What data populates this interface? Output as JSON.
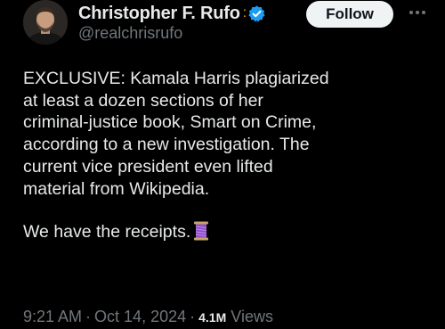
{
  "author": {
    "display_name": "Christopher F. Rufo",
    "name_separator": ":",
    "handle": "@realchrisrufo",
    "verified": true,
    "verified_color": "#1d9bf0"
  },
  "follow_button": {
    "label": "Follow"
  },
  "more_icon": "more-horizontal-icon",
  "tweet": {
    "lines": [
      "EXCLUSIVE: Kamala Harris plagiarized",
      "at least a dozen sections of her",
      "criminal-justice book, Smart on Crime,",
      "according to a new investigation. The",
      "current vice president even lifted",
      "material from Wikipedia."
    ],
    "closing_line": "We have the receipts.",
    "closing_emoji": "spool-of-thread-icon"
  },
  "meta": {
    "time": "9:21 AM",
    "separator": "·",
    "date": "Oct 14, 2024",
    "views_count": "4.1M",
    "views_label": "Views"
  },
  "colors": {
    "background": "#000000",
    "text": "#e7e9ea",
    "secondary_text": "#71767b",
    "button_bg": "#eff3f4",
    "button_text": "#0f1419"
  }
}
